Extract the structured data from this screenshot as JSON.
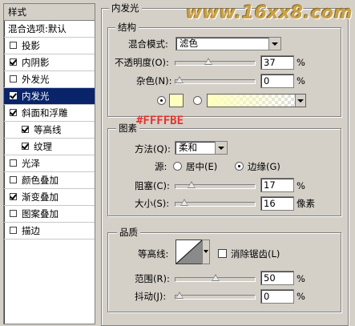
{
  "sidebar": {
    "header": "样式",
    "items": [
      {
        "label": "混合选项:默认",
        "checkbox": false,
        "checked": false,
        "selected": false
      },
      {
        "label": "投影",
        "checkbox": true,
        "checked": false,
        "selected": false
      },
      {
        "label": "内阴影",
        "checkbox": true,
        "checked": true,
        "selected": false
      },
      {
        "label": "外发光",
        "checkbox": true,
        "checked": false,
        "selected": false
      },
      {
        "label": "内发光",
        "checkbox": true,
        "checked": true,
        "selected": true
      },
      {
        "label": "斜面和浮雕",
        "checkbox": true,
        "checked": true,
        "selected": false
      },
      {
        "label": "等高线",
        "checkbox": true,
        "checked": true,
        "selected": false,
        "indent": true
      },
      {
        "label": "纹理",
        "checkbox": true,
        "checked": true,
        "selected": false,
        "indent": true
      },
      {
        "label": "光泽",
        "checkbox": true,
        "checked": false,
        "selected": false
      },
      {
        "label": "颜色叠加",
        "checkbox": true,
        "checked": false,
        "selected": false
      },
      {
        "label": "渐变叠加",
        "checkbox": true,
        "checked": true,
        "selected": false
      },
      {
        "label": "图案叠加",
        "checkbox": true,
        "checked": false,
        "selected": false
      },
      {
        "label": "描边",
        "checkbox": true,
        "checked": false,
        "selected": false
      }
    ]
  },
  "panel": {
    "title": "内发光",
    "watermark": "www.16xx8.com",
    "structure": {
      "title": "结构",
      "blend_mode_label": "混合模式:",
      "blend_mode_value": "滤色",
      "opacity_label": "不透明度(O):",
      "opacity_value": "37",
      "opacity_unit": "%",
      "opacity_fraction": 0.37,
      "noise_label": "杂色(N):",
      "noise_value": "0",
      "noise_unit": "%",
      "noise_fraction": 0.0,
      "glow_color": "#FFFFBE"
    },
    "annotation": "#FFFFBE",
    "elements": {
      "title": "图素",
      "method_label": "方法(Q):",
      "method_value": "柔和",
      "source_label": "源:",
      "source_center": "居中(E)",
      "source_edge": "边缘(G)",
      "choke_label": "阻塞(C):",
      "choke_value": "17",
      "choke_unit": "%",
      "choke_fraction": 0.17,
      "size_label": "大小(S):",
      "size_value": "16",
      "size_unit": "像素",
      "size_fraction": 0.064
    },
    "quality": {
      "title": "品质",
      "contour_label": "等高线:",
      "antialias_label": "消除锯齿(L)",
      "range_label": "范围(R):",
      "range_value": "50",
      "range_unit": "%",
      "range_fraction": 0.5,
      "jitter_label": "抖动(J):",
      "jitter_value": "0",
      "jitter_unit": "%",
      "jitter_fraction": 0.0
    }
  }
}
